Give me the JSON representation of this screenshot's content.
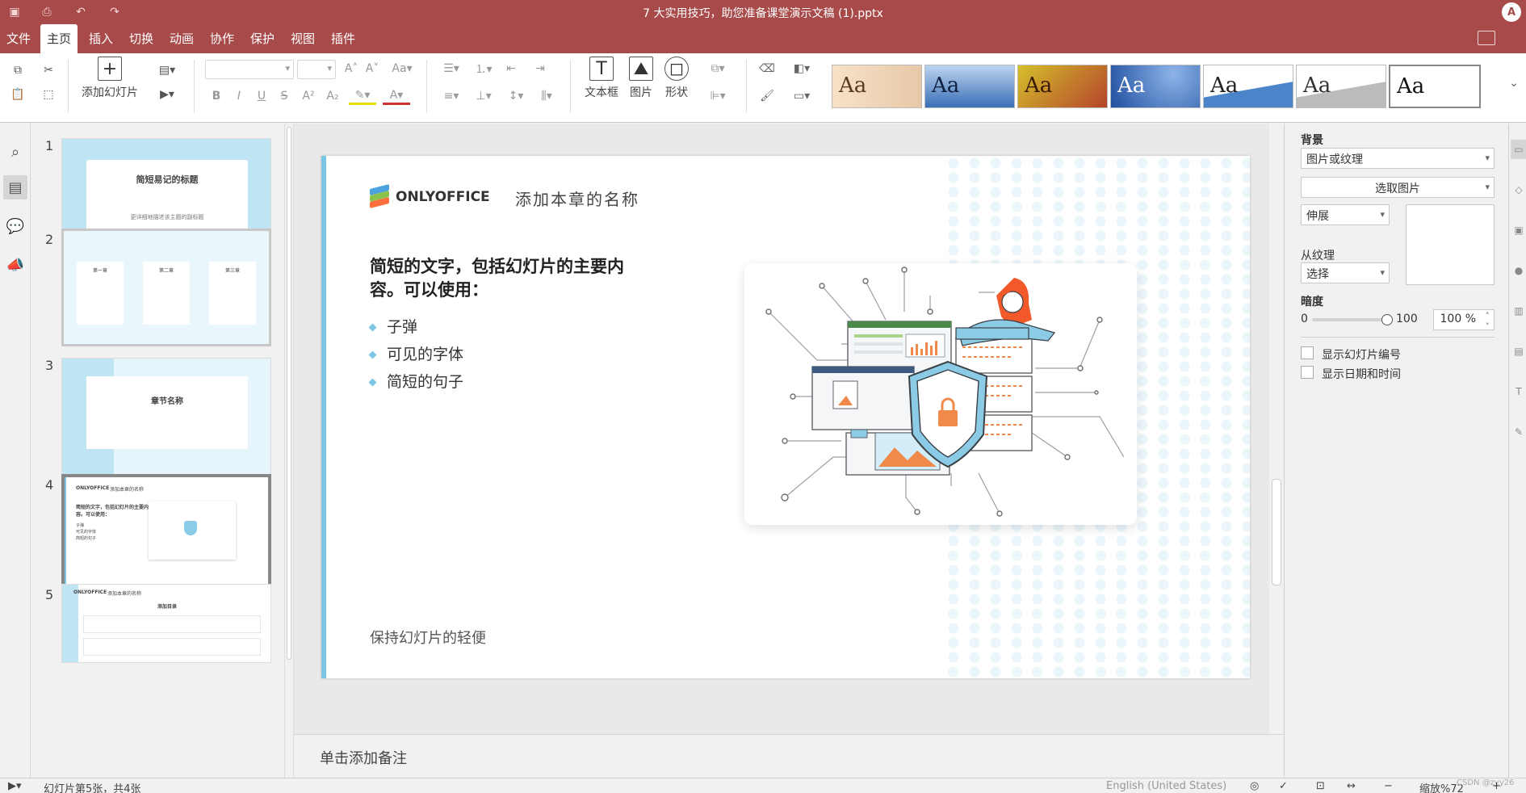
{
  "window": {
    "title": "7 大实用技巧，助您准备课堂演示文稿 (1).pptx",
    "user_initial": "A"
  },
  "quick_access": [
    {
      "name": "save",
      "icon": "save-icon"
    },
    {
      "name": "print",
      "icon": "print-icon"
    },
    {
      "name": "undo",
      "icon": "undo-icon"
    },
    {
      "name": "redo",
      "icon": "redo-icon"
    }
  ],
  "menu": {
    "tabs": [
      "文件",
      "主页",
      "插入",
      "切换",
      "动画",
      "协作",
      "保护",
      "视图",
      "插件"
    ],
    "active": "主页"
  },
  "toolbar": {
    "add_slide_label": "添加幻灯片",
    "textbox_label": "文本框",
    "image_label": "图片",
    "shape_label": "形状",
    "font_name": "",
    "font_size": "",
    "format_buttons": [
      "B",
      "I",
      "U",
      "S",
      "A²",
      "A₂"
    ],
    "themes": [
      "Aa",
      "Aa",
      "Aa",
      "Aa",
      "Aa",
      "Aa",
      "Aa"
    ]
  },
  "slides": [
    {
      "num": "1",
      "title": "简短易记的标题",
      "subtitle": "更详细地描述该主题的副标题"
    },
    {
      "num": "2",
      "cols": [
        "第一章",
        "第二章",
        "第三章"
      ]
    },
    {
      "num": "3",
      "title": "章节名称"
    },
    {
      "num": "4",
      "selected": true
    },
    {
      "num": "5",
      "title": "添加本章的名称",
      "sub": "添加目录"
    }
  ],
  "current_slide": {
    "brand": "ONLYOFFICE",
    "chapter": "添加本章的名称",
    "heading": "简短的文字，包括幻灯片的主要内容。可以使用：",
    "bullets": [
      "子弹",
      "可见的字体",
      "简短的句子"
    ],
    "footer": "保持幻灯片的轻便"
  },
  "notes_placeholder": "单击添加备注",
  "right_panel": {
    "background_label": "背景",
    "fill_type": "图片或纹理",
    "select_image": "选取图片",
    "stretch": "伸展",
    "from_texture_label": "从纹理",
    "texture_select": "选择",
    "transparency_label": "暗度",
    "slider_min": "0",
    "slider_max": "100",
    "transparency_value": "100 %",
    "show_slide_number": "显示幻灯片编号",
    "show_date_time": "显示日期和时间"
  },
  "status": {
    "slide_info": "幻灯片第5张，共4张",
    "language": "English (United States)",
    "zoom": "缩放%72",
    "watermark": "CSDN @zyy26"
  },
  "colors": {
    "accent": "#a94a4a",
    "slide_accent": "#7cc5e4",
    "shield": "#8ccbe6",
    "lock": "#f08a4b"
  }
}
